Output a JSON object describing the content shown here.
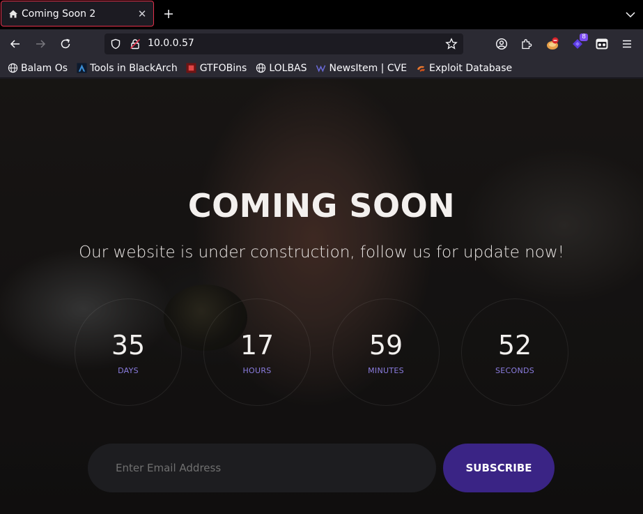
{
  "browser": {
    "tab": {
      "title": "Coming Soon 2",
      "favicon": "house-icon",
      "active_border_color": "#e5304b"
    },
    "url": "10.0.0.57",
    "extensions": {
      "badge_count": "8"
    },
    "bookmarks": [
      {
        "label": "Balam Os",
        "icon": "globe-icon"
      },
      {
        "label": "Tools in BlackArch",
        "icon": "blackarch-icon"
      },
      {
        "label": "GTFOBins",
        "icon": "gtfobins-icon"
      },
      {
        "label": "LOLBAS",
        "icon": "globe-icon"
      },
      {
        "label": "NewsItem | CVE",
        "icon": "cve-icon"
      },
      {
        "label": "Exploit Database",
        "icon": "exploitdb-icon"
      }
    ]
  },
  "page": {
    "headline": "COMING SOON",
    "subtitle": "Our website is under construction, follow us for update now!",
    "countdown": [
      {
        "value": "35",
        "unit": "DAYS"
      },
      {
        "value": "17",
        "unit": "HOURS"
      },
      {
        "value": "59",
        "unit": "MINUTES"
      },
      {
        "value": "52",
        "unit": "SECONDS"
      }
    ],
    "email_placeholder": "Enter Email Address",
    "subscribe_label": "SUBSCRIBE",
    "accent_color": "#3a2485",
    "unit_label_color": "#8b7de0"
  }
}
